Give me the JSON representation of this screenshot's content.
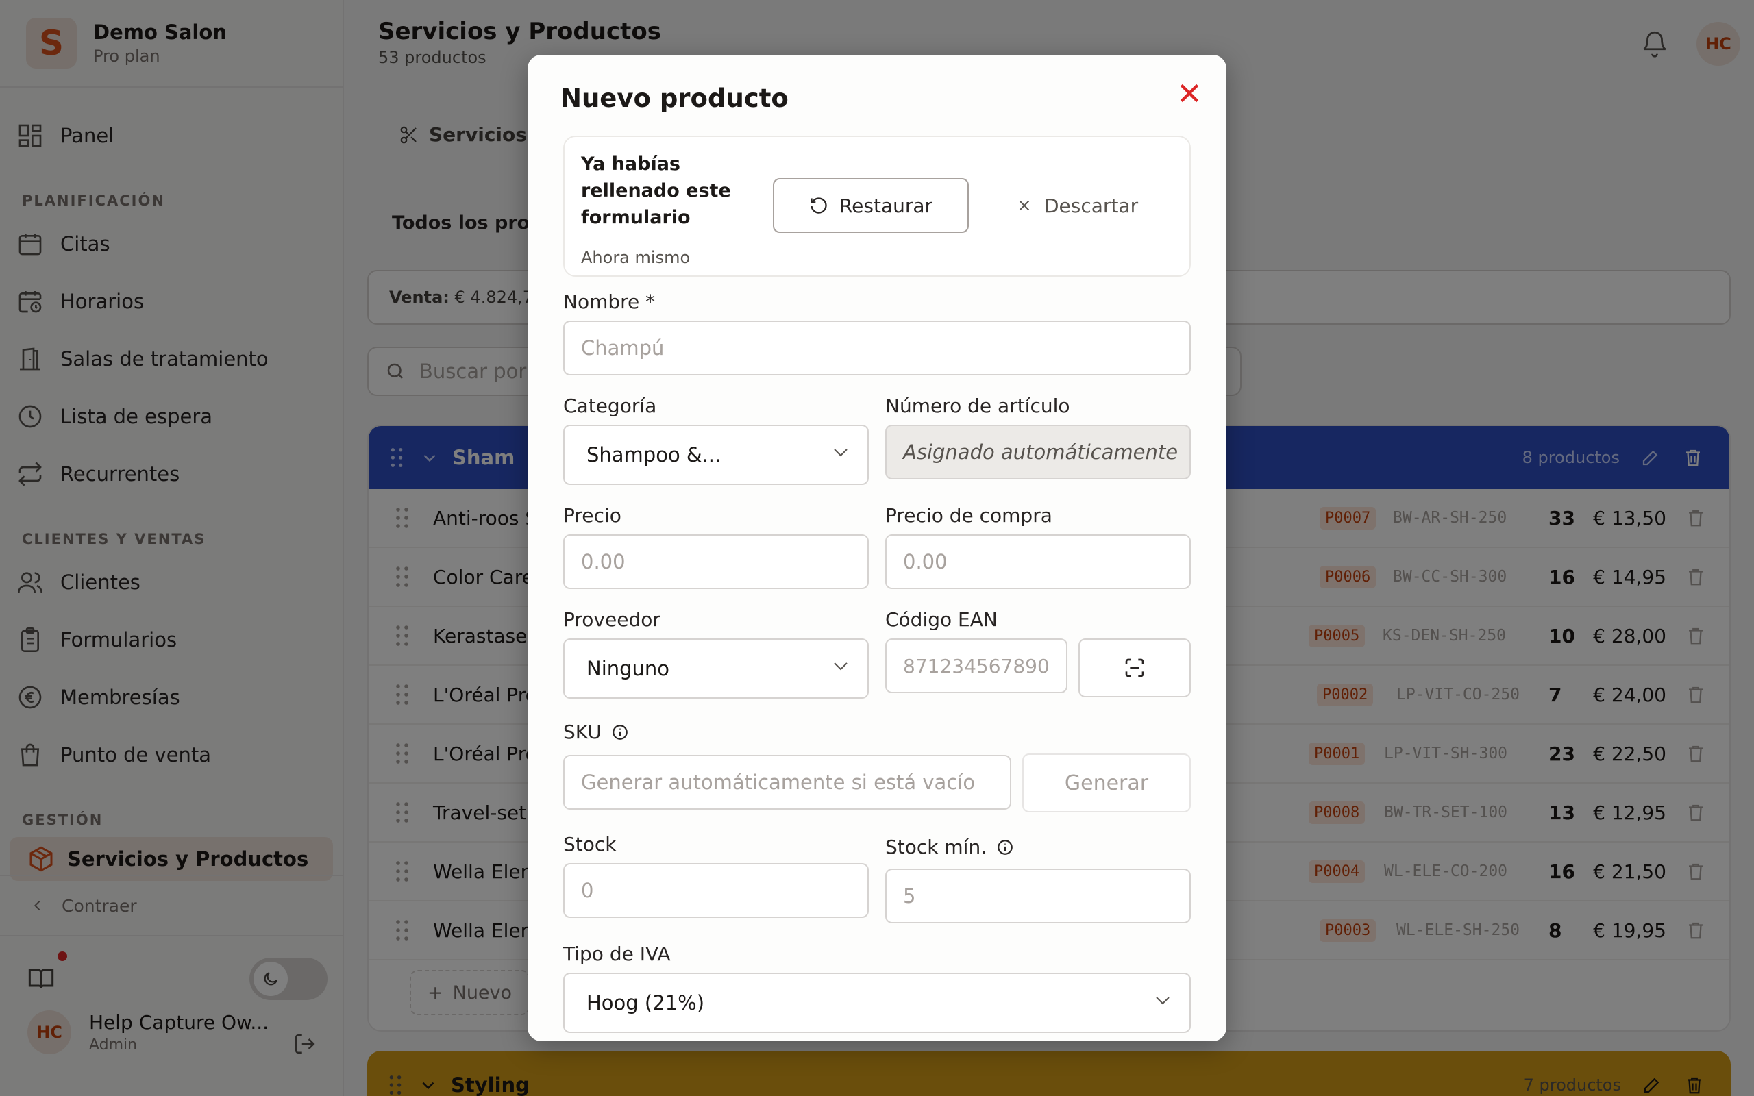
{
  "app": {
    "name": "Demo Salon",
    "plan": "Pro plan",
    "logo_letter": "S"
  },
  "nav": {
    "panel": "Panel",
    "section_planning": "PLANIFICACIÓN",
    "citas": "Citas",
    "horarios": "Horarios",
    "salas": "Salas de tratamiento",
    "espera": "Lista de espera",
    "recurrentes": "Recurrentes",
    "section_clients": "CLIENTES Y VENTAS",
    "clientes": "Clientes",
    "formularios": "Formularios",
    "membresias": "Membresías",
    "pos": "Punto de venta",
    "section_management": "GESTIÓN",
    "servicios": "Servicios y Productos",
    "collapse": "Contraer"
  },
  "user": {
    "initials": "HC",
    "name": "Help Capture Ow...",
    "role": "Admin"
  },
  "header": {
    "title": "Servicios y Productos",
    "subtitle": "53 productos",
    "avatar": "HC"
  },
  "tabs": {
    "services": "Servicios"
  },
  "filters": {
    "all_products": "Todos los proc"
  },
  "stats": {
    "label": "Venta:",
    "value": "€ 4.824,7"
  },
  "search": {
    "placeholder": "Buscar por"
  },
  "category1": {
    "name": "Sham",
    "count": "8 productos",
    "products": [
      {
        "name": "Anti-roos S",
        "number": "P0007",
        "sku": "BW-AR-SH-250",
        "stock": "33",
        "price": "€ 13,50"
      },
      {
        "name": "Color Care",
        "number": "P0006",
        "sku": "BW-CC-SH-300",
        "stock": "16",
        "price": "€ 14,95"
      },
      {
        "name": "Kerastase",
        "number": "P0005",
        "sku": "KS-DEN-SH-250",
        "stock": "10",
        "price": "€ 28,00"
      },
      {
        "name": "L'Oréal Pro",
        "number": "P0002",
        "sku": "LP-VIT-CO-250",
        "stock": "7",
        "price": "€ 24,00"
      },
      {
        "name": "L'Oréal Pro",
        "number": "P0001",
        "sku": "LP-VIT-SH-300",
        "stock": "23",
        "price": "€ 22,50"
      },
      {
        "name": "Travel-set",
        "number": "P0008",
        "sku": "BW-TR-SET-100",
        "stock": "13",
        "price": "€ 12,95"
      },
      {
        "name": "Wella Elen",
        "number": "P0004",
        "sku": "WL-ELE-CO-200",
        "stock": "16",
        "price": "€ 21,50"
      },
      {
        "name": "Wella Elen",
        "number": "P0003",
        "sku": "WL-ELE-SH-250",
        "stock": "8",
        "price": "€ 19,95"
      }
    ],
    "new_button": "Nuevo"
  },
  "category2": {
    "name": "Styling",
    "count": "7 productos"
  },
  "modal": {
    "title": "Nuevo producto",
    "draft": {
      "title": "Ya habías rellenado este formulario",
      "time": "Ahora mismo",
      "restore": "Restaurar",
      "discard": "Descartar"
    },
    "name_label": "Nombre *",
    "name_placeholder": "Champú",
    "category_label": "Categoría",
    "category_value": "Shampoo &...",
    "article_label": "Número de artículo",
    "article_value": "Asignado automáticamente",
    "price_label": "Precio",
    "price_placeholder": "0.00",
    "purchase_label": "Precio de compra",
    "purchase_placeholder": "0.00",
    "supplier_label": "Proveedor",
    "supplier_value": "Ninguno",
    "ean_label": "Código EAN",
    "ean_placeholder": "871234567890",
    "sku_label": "SKU",
    "sku_placeholder": "Generar automáticamente si está vacío",
    "generate": "Generar",
    "stock_label": "Stock",
    "stock_placeholder": "0",
    "minstock_label": "Stock mín.",
    "minstock_placeholder": "5",
    "vat_label": "Tipo de IVA",
    "vat_value": "Hoog (21%)"
  },
  "colors": {
    "accent": "#d9501c",
    "category_blue": "#2f4ec2",
    "category_yellow": "#d49c18",
    "close_red": "#dc2626"
  }
}
